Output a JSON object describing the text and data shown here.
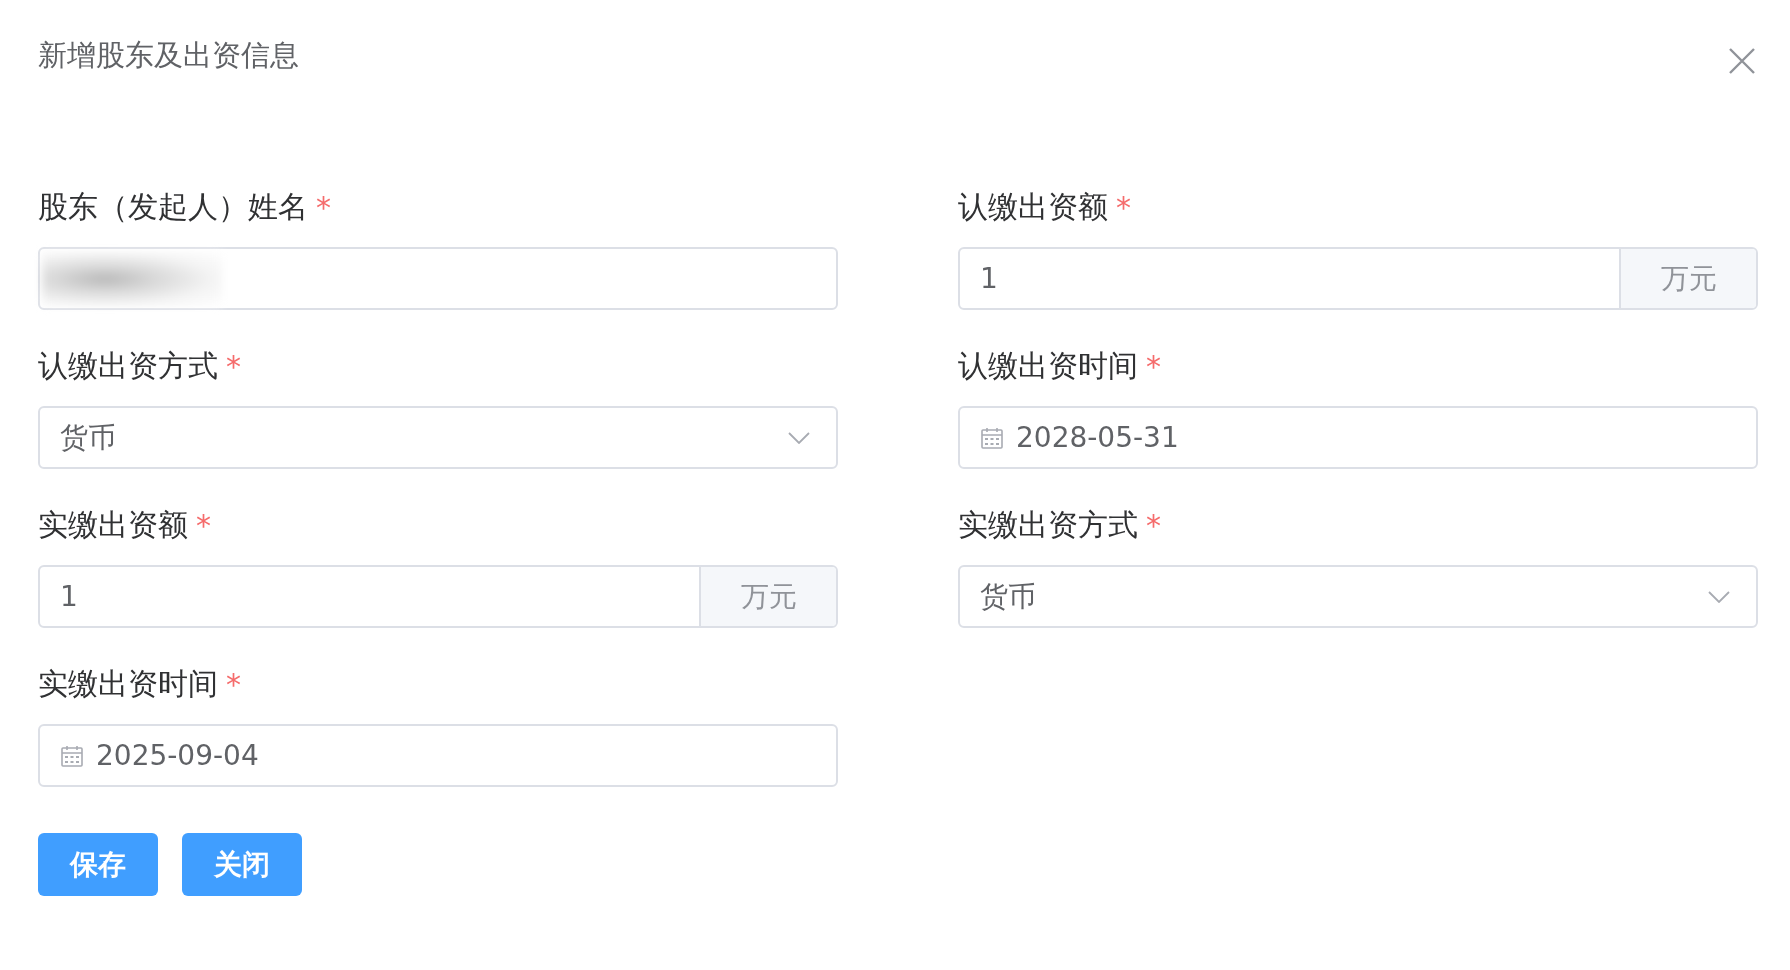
{
  "dialog": {
    "title": "新增股东及出资信息"
  },
  "fields": [
    {
      "label": "股东（发起人）姓名",
      "required_mark": "*",
      "kind": "blurred"
    },
    {
      "label": "认缴出资额",
      "required_mark": "*",
      "kind": "addon",
      "value": "1",
      "suffix": "万元"
    },
    {
      "label": "认缴出资方式",
      "required_mark": "*",
      "kind": "select",
      "value": "货币"
    },
    {
      "label": "认缴出资时间",
      "required_mark": "*",
      "kind": "date",
      "value": "2028-05-31"
    },
    {
      "label": "实缴出资额",
      "required_mark": "*",
      "kind": "addon",
      "value": "1",
      "suffix": "万元"
    },
    {
      "label": "实缴出资方式",
      "required_mark": "*",
      "kind": "select",
      "value": "货币"
    },
    {
      "label": "实缴出资时间",
      "required_mark": "*",
      "kind": "date",
      "value": "2025-09-04"
    }
  ],
  "buttons": [
    "保存",
    "关闭"
  ]
}
